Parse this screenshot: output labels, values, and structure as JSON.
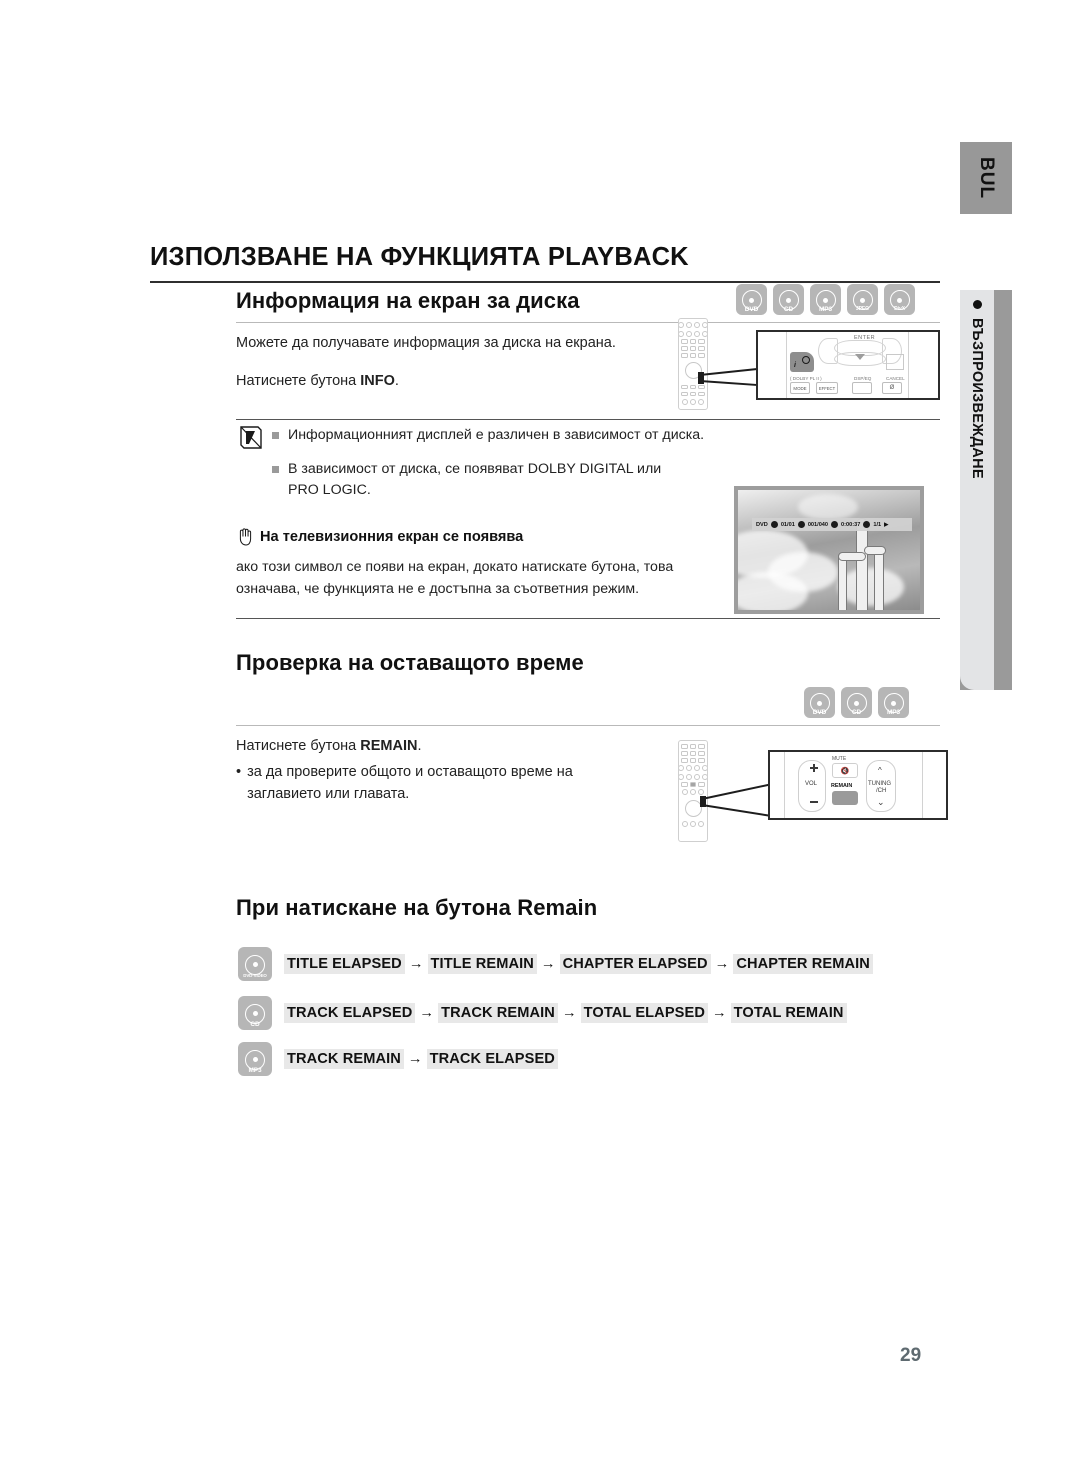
{
  "sidebar": {
    "language_tab": "BUL",
    "chapter_label": "ВЪЗПРОИЗВЕЖДАНЕ"
  },
  "page": {
    "title": "ИЗПОЛЗВАНЕ НА ФУНКЦИЯТА PLAYBACK",
    "number": "29"
  },
  "section1": {
    "heading": "Информация на екран за диска",
    "discs": [
      {
        "name": "DVD",
        "label": "DVD"
      },
      {
        "name": "CD",
        "label": "CD"
      },
      {
        "name": "MP3",
        "label": "MP3"
      },
      {
        "name": "JPEG",
        "label": "JPEG"
      },
      {
        "name": "DivX",
        "label": "DivX"
      }
    ],
    "para1": "Можете да получавате информация за диска на екрана.",
    "para2_pre": "Натиснете бутона ",
    "para2_bold": "INFO",
    "para2_post": "."
  },
  "note": {
    "bullet1": "Информационният дисплей е различен в зависимост от диска.",
    "bullet2_line1": "В зависимост от диска, се появяват  DOLBY DIGITAL или",
    "bullet2_line2": "PRO LOGIC.",
    "hand_heading": "На телевизионния екран се появява",
    "hand_para_line1": "ако този символ се появи на екран, докато натискате бутона, това",
    "hand_para_line2": "означава, че функцията не е достъпна за съответния режим."
  },
  "tv_osd": {
    "disc_type": "DVD",
    "title": "01/01",
    "chapter": "001/040",
    "time": "0:00:37",
    "audio": "1/1"
  },
  "remote1": {
    "enter_label": "ENTER",
    "mode_label": "MODE",
    "effect_label": "EFFECT",
    "dsp_label": "DSP/EQ",
    "cancel_label": "CANCEL",
    "pl_label": "( DOLBY PL II )"
  },
  "section2": {
    "heading": "Проверка на оставащото време",
    "discs": [
      {
        "name": "DVD",
        "label": "DVD"
      },
      {
        "name": "CD",
        "label": "CD"
      },
      {
        "name": "MP3",
        "label": "MP3"
      }
    ],
    "para1_pre": "Натиснете бутона ",
    "para1_bold": "REMAIN",
    "para1_post": ".",
    "bullet_line1": "за да проверите общото и оставащото време на",
    "bullet_line2": "заглавието или главата."
  },
  "remote2": {
    "vol_label": "VOL",
    "mute_label": "MUTE",
    "remain_label": "REMAIN",
    "tuning_label_1": "TUNING",
    "tuning_label_2": "/CH"
  },
  "section3": {
    "heading": "При натискане на бутона Remain",
    "rows": [
      {
        "disc": "DVD-VIDEO",
        "steps": [
          "TITLE ELAPSED",
          "TITLE REMAIN",
          "CHAPTER ELAPSED",
          "CHAPTER REMAIN"
        ]
      },
      {
        "disc": "CD",
        "steps": [
          "TRACK ELAPSED",
          "TRACK REMAIN",
          "TOTAL ELAPSED",
          "TOTAL REMAIN"
        ]
      },
      {
        "disc": "MP3",
        "steps": [
          "TRACK REMAIN",
          "TRACK ELAPSED"
        ]
      }
    ],
    "arrow": "→"
  },
  "colors": {
    "disc_badge": "#b6b6b6",
    "sidebar": "#9a9a9a",
    "chip": "#e8e8e8",
    "page_number": "#5e6a70"
  }
}
